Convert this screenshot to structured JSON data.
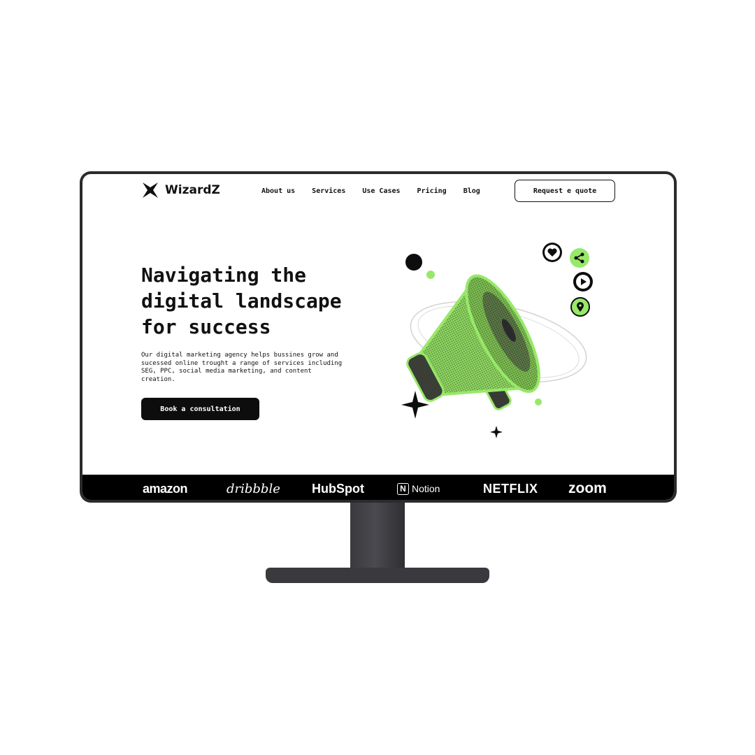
{
  "brand": {
    "name": "WizardZ",
    "logo_icon": "four-point-star-icon"
  },
  "nav": {
    "items": [
      {
        "label": "About us"
      },
      {
        "label": "Services"
      },
      {
        "label": "Use Cases"
      },
      {
        "label": "Pricing"
      },
      {
        "label": "Blog"
      }
    ],
    "cta_label": "Request e quote"
  },
  "hero": {
    "title_lines": [
      "Navigating the",
      "digital landscape",
      "for success"
    ],
    "description": "Our digital marketing agency helps bussines grow and sucessed online trought a range of services including SEG, PPC, social media marketing, and content creation.",
    "cta_label": "Book a consultation"
  },
  "illustration": {
    "subject": "megaphone",
    "social_icons": [
      "heart-icon",
      "share-icon",
      "play-icon",
      "location-pin-icon"
    ]
  },
  "clients": {
    "logos": [
      "amazon",
      "dribbble",
      "HubSpot",
      "Notion",
      "NETFLIX",
      "zoom"
    ]
  },
  "colors": {
    "accent": "#98e86a",
    "dark": "#0d0d0d",
    "monitor": "#2b2b2e"
  }
}
